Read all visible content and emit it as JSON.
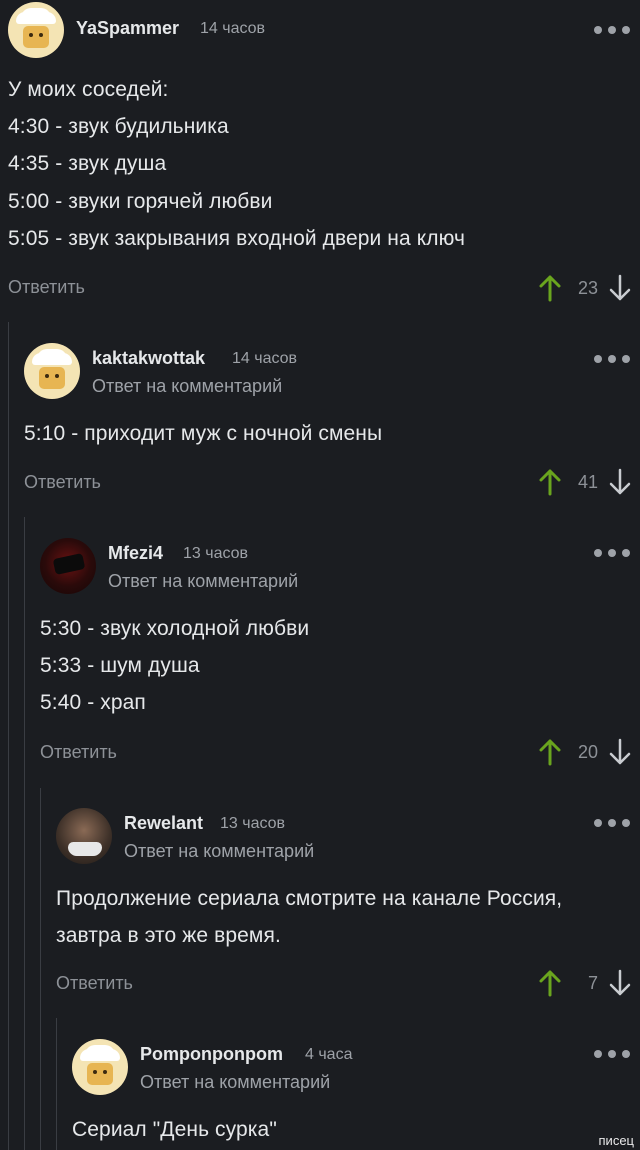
{
  "reply_label": "Ответить",
  "reply_to_label": "Ответ на комментарий",
  "colors": {
    "upvote": "#6aa51e",
    "background": "#1b1d21"
  },
  "comments": [
    {
      "username": "YaSpammer",
      "time": "14 часов",
      "avatar": "chef-icon",
      "reply_to": "",
      "lines": [
        "У моих соседей:",
        "4:30 - звук будильника",
        "4:35 - звук душа",
        "5:00 - звуки горячей любви",
        "5:05 - звук закрывания входной двери на ключ"
      ],
      "votes": "23"
    },
    {
      "username": "kaktakwottak",
      "time": "14 часов",
      "avatar": "chef-icon",
      "reply_to": "Ответ на комментарий",
      "lines": [
        "5:10 - приходит муж с ночной смены"
      ],
      "votes": "41"
    },
    {
      "username": "Mfezi4",
      "time": "13 часов",
      "avatar": "user-photo",
      "reply_to": "Ответ на комментарий",
      "lines": [
        "5:30 - звук холодной любви",
        "5:33 - шум душа",
        "5:40 - храп"
      ],
      "votes": "20"
    },
    {
      "username": "Rewelant",
      "time": "13 часов",
      "avatar": "user-photo",
      "reply_to": "Ответ на комментарий",
      "lines": [
        "Продолжение сериала смотрите на канале Россия,",
        "завтра в это же время."
      ],
      "votes": "7"
    },
    {
      "username": "Pomponponpom",
      "time": "4 часа",
      "avatar": "chef-icon",
      "reply_to": "Ответ на комментарий",
      "lines": [
        "Сериал \"День сурка\""
      ],
      "votes": ""
    }
  ],
  "watermark": "писец"
}
